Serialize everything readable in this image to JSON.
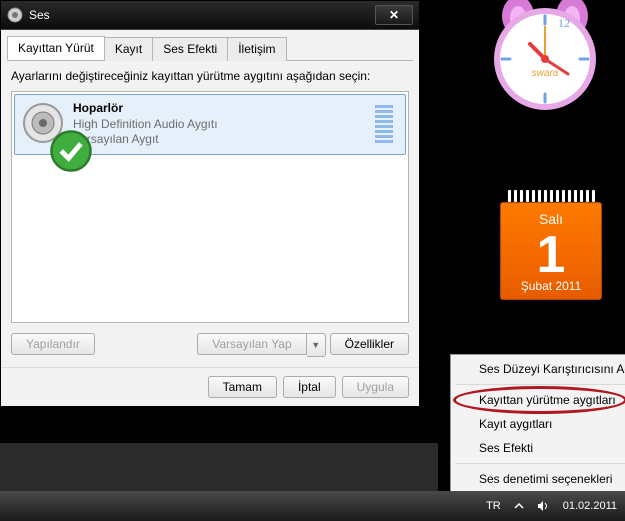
{
  "dialog": {
    "title": "Ses",
    "tabs": [
      "Kayıttan Yürüt",
      "Kayıt",
      "Ses Efekti",
      "İletişim"
    ],
    "instruction": "Ayarlarını değiştireceğiniz kayıttan yürütme aygıtını aşağıdan seçin:",
    "device": {
      "name": "Hoparlör",
      "line1": "High Definition Audio Aygıtı",
      "line2": "Varsayılan Aygıt"
    },
    "buttons": {
      "configure": "Yapılandır",
      "set_default": "Varsayılan Yap",
      "properties": "Özellikler",
      "ok": "Tamam",
      "cancel": "İptal",
      "apply": "Uygula"
    }
  },
  "calendar": {
    "day": "Salı",
    "num": "1",
    "month": "Şubat 2011"
  },
  "clock": {
    "brand": "swara"
  },
  "context_menu": {
    "items": [
      "Ses Düzeyi Karıştırıcısını Aç",
      "Kayıttan yürütme aygıtları",
      "Kayıt aygıtları",
      "Ses Efekti",
      "Ses denetimi seçenekleri"
    ],
    "highlight_index": 1,
    "sep_after": [
      0,
      3
    ]
  },
  "taskbar": {
    "lang": "TR",
    "date": "01.02.2011"
  }
}
